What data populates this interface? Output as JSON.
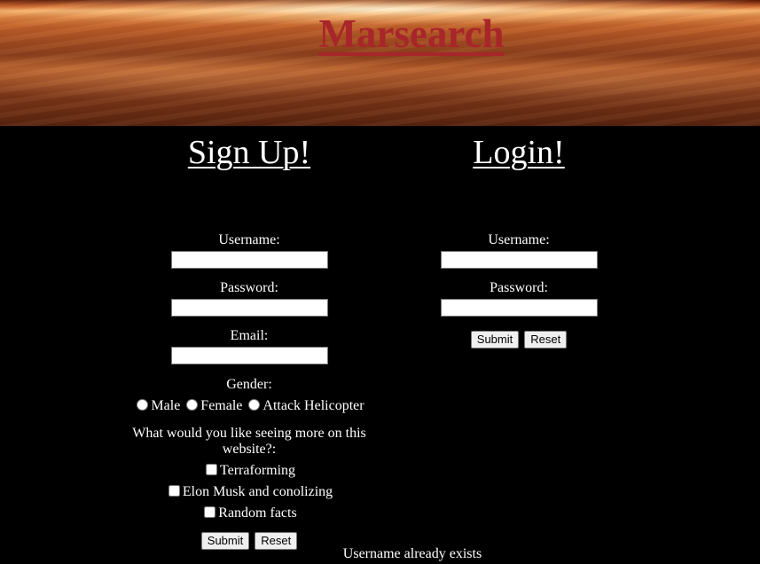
{
  "site": {
    "title": "Marsearch"
  },
  "signup": {
    "heading": "Sign Up!",
    "username_label": "Username:",
    "username_value": "",
    "password_label": "Password:",
    "password_value": "",
    "email_label": "Email:",
    "email_value": "",
    "gender_label": "Gender:",
    "gender_options": [
      "Male",
      "Female",
      "Attack Helicopter"
    ],
    "interest_question": "What would you like seeing more on this website?:",
    "interest_options": [
      "Terraforming",
      "Elon Musk and conolizing",
      "Random facts"
    ],
    "submit_label": "Submit",
    "reset_label": "Reset"
  },
  "login": {
    "heading": "Login!",
    "username_label": "Username:",
    "username_value": "",
    "password_label": "Password:",
    "password_value": "",
    "submit_label": "Submit",
    "reset_label": "Reset"
  },
  "status": {
    "message": "Username already exists"
  },
  "colors": {
    "background": "#000000",
    "title": "#a8262a",
    "text": "#ffffff"
  }
}
